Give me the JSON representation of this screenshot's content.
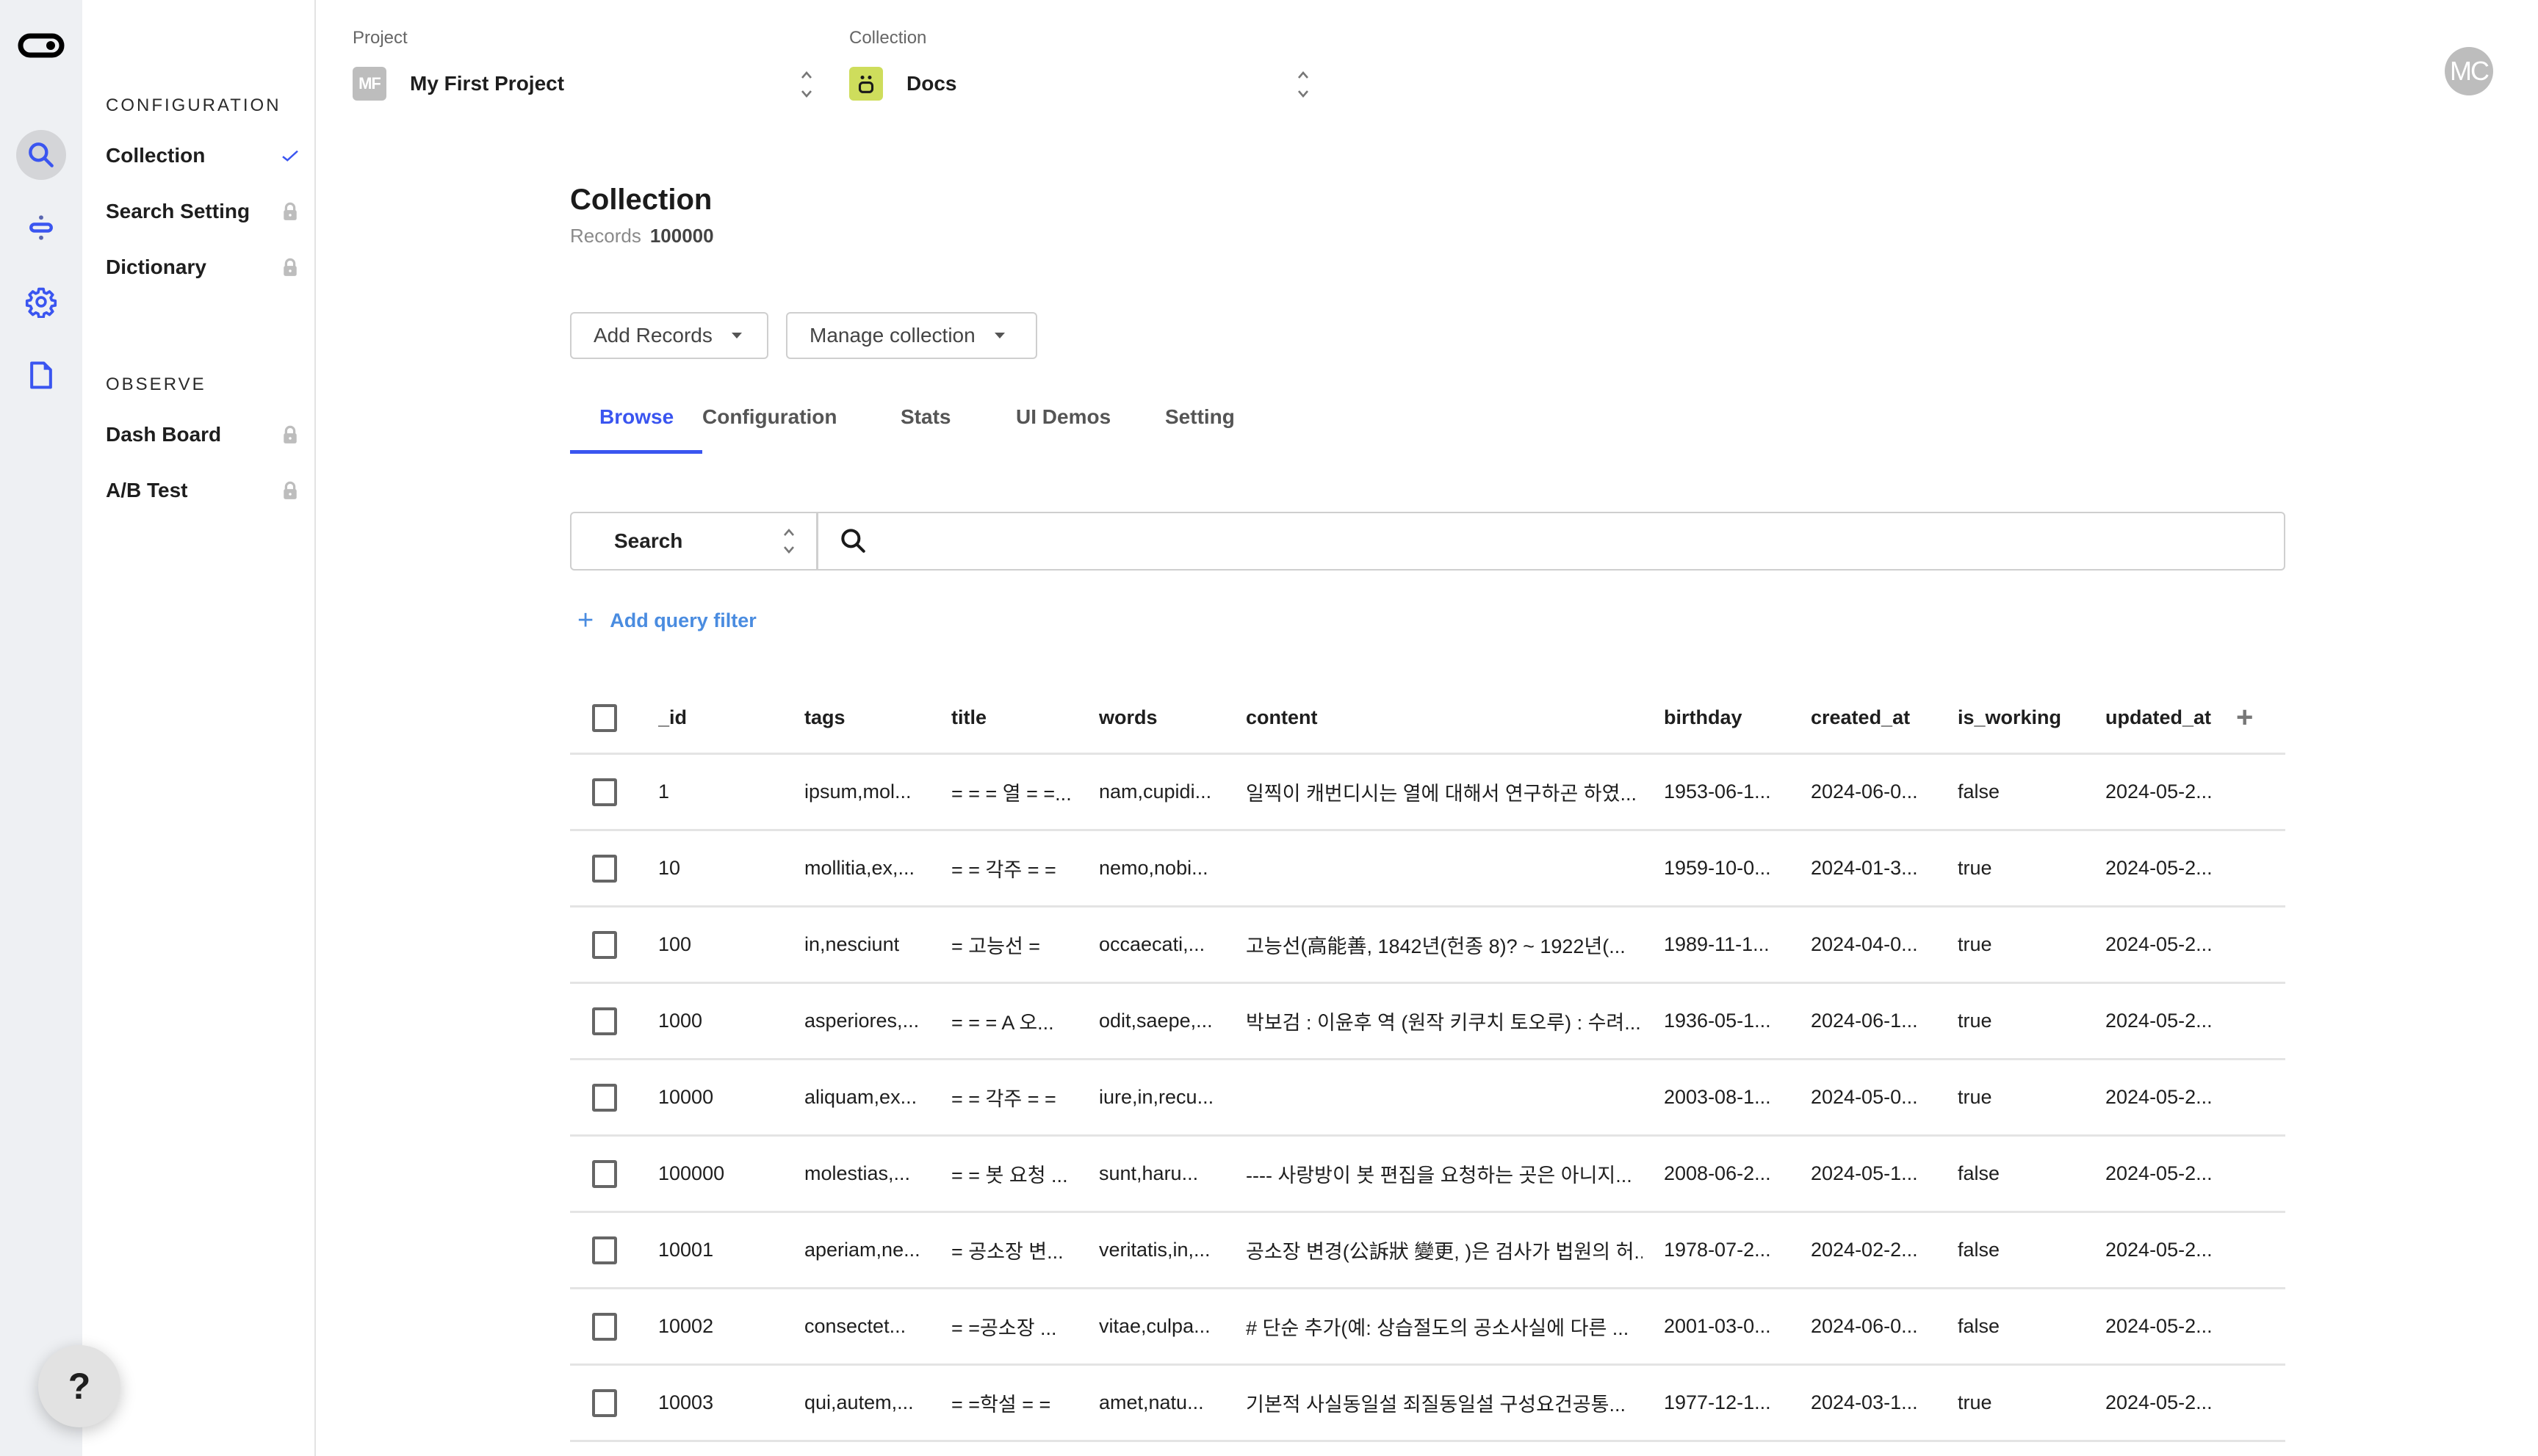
{
  "colors": {
    "accent": "#3a55f0",
    "link": "#4a8ce0",
    "rail_bg": "#eef0f3",
    "project_badge": "#bdbdbd",
    "collection_badge": "#cedd5c",
    "lock": "#bdbdbd"
  },
  "rail": {
    "logo": "toggle-logo-icon",
    "items": [
      {
        "icon": "search-icon",
        "active": true
      },
      {
        "icon": "pipeline-icon",
        "active": false
      },
      {
        "icon": "gear-icon",
        "active": false
      },
      {
        "icon": "document-icon",
        "active": false
      }
    ]
  },
  "nav": {
    "sections": [
      {
        "title": "CONFIGURATION",
        "items": [
          {
            "label": "Collection",
            "status": "check"
          },
          {
            "label": "Search Setting",
            "status": "locked"
          },
          {
            "label": "Dictionary",
            "status": "locked"
          }
        ]
      },
      {
        "title": "OBSERVE",
        "items": [
          {
            "label": "Dash Board",
            "status": "locked"
          },
          {
            "label": "A/B Test",
            "status": "locked"
          }
        ]
      }
    ]
  },
  "header": {
    "project": {
      "label": "Project",
      "badge": "MF",
      "value": "My First Project"
    },
    "collection": {
      "label": "Collection",
      "badge_icon": "smiley-icon",
      "value": "Docs"
    },
    "avatar": "MC"
  },
  "main": {
    "title": "Collection",
    "records_label": "Records",
    "records_value": "100000",
    "buttons": {
      "add_records": "Add Records",
      "manage_collection": "Manage collection"
    },
    "tabs": [
      {
        "label": "Browse",
        "active": true
      },
      {
        "label": "Configuration",
        "active": false
      },
      {
        "label": "Stats",
        "active": false
      },
      {
        "label": "UI Demos",
        "active": false
      },
      {
        "label": "Setting",
        "active": false
      }
    ],
    "search": {
      "type": "Search",
      "value": "",
      "placeholder": ""
    },
    "add_filter": "Add query filter"
  },
  "table": {
    "columns": [
      "_id",
      "tags",
      "title",
      "words",
      "content",
      "birthday",
      "created_at",
      "is_working",
      "updated_at"
    ],
    "rows": [
      [
        "1",
        "ipsum,mol...",
        "= = = 열 = =...",
        "nam,cupidi...",
        "일찍이 캐번디시는 열에 대해서 연구하곤 하였...",
        "1953-06-1...",
        "2024-06-0...",
        "false",
        "2024-05-2..."
      ],
      [
        "10",
        "mollitia,ex,...",
        "= = 각주 = =",
        "nemo,nobi...",
        "",
        "1959-10-0...",
        "2024-01-3...",
        "true",
        "2024-05-2..."
      ],
      [
        "100",
        "in,nesciunt",
        "= 고능선 =",
        "occaecati,...",
        "고능선(高能善, 1842년(헌종 8)? ~ 1922년(...",
        "1989-11-1...",
        "2024-04-0...",
        "true",
        "2024-05-2..."
      ],
      [
        "1000",
        "asperiores,...",
        "= = = A 오...",
        "odit,saepe,...",
        "박보검 : 이윤후 역 (원작 키쿠치 토오루) : 수려...",
        "1936-05-1...",
        "2024-06-1...",
        "true",
        "2024-05-2..."
      ],
      [
        "10000",
        "aliquam,ex...",
        "= = 각주 = =",
        "iure,in,recu...",
        "",
        "2003-08-1...",
        "2024-05-0...",
        "true",
        "2024-05-2..."
      ],
      [
        "100000",
        "molestias,...",
        "= = 봇 요청 ...",
        "sunt,haru...",
        "---- 사랑방이 봇 편집을 요청하는 곳은 아니지...",
        "2008-06-2...",
        "2024-05-1...",
        "false",
        "2024-05-2..."
      ],
      [
        "10001",
        "aperiam,ne...",
        "= 공소장 변...",
        "veritatis,in,...",
        "공소장 변경(公訴狀 變更, )은 검사가 법원의 허...",
        "1978-07-2...",
        "2024-02-2...",
        "false",
        "2024-05-2..."
      ],
      [
        "10002",
        "consectet...",
        "= =공소장 ...",
        "vitae,culpa...",
        "# 단순 추가(예: 상습절도의 공소사실에 다른 ...",
        "2001-03-0...",
        "2024-06-0...",
        "false",
        "2024-05-2..."
      ],
      [
        "10003",
        "qui,autem,...",
        "= =학설 = =",
        "amet,natu...",
        "기본적 사실동일설 죄질동일설 구성요건공통...",
        "1977-12-1...",
        "2024-03-1...",
        "true",
        "2024-05-2..."
      ]
    ]
  },
  "help": "?"
}
